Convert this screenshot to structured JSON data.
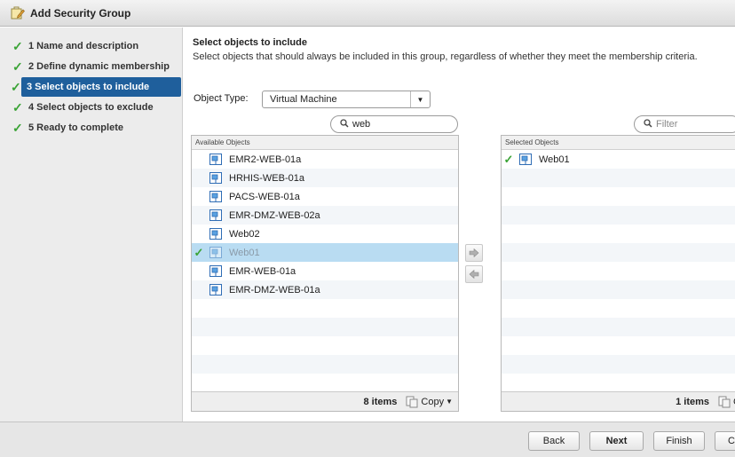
{
  "window": {
    "title": "Add Security Group"
  },
  "steps": [
    {
      "label": "1 Name and description",
      "done": true,
      "active": false
    },
    {
      "label": "2 Define dynamic membership",
      "done": true,
      "active": false
    },
    {
      "label": "3 Select objects to include",
      "done": true,
      "active": true
    },
    {
      "label": "4 Select objects to exclude",
      "done": true,
      "active": false
    },
    {
      "label": "5 Ready to complete",
      "done": true,
      "active": false
    }
  ],
  "header": {
    "title": "Select objects to include",
    "subtitle": "Select objects that should always be included in this group, regardless of whether they meet the membership criteria."
  },
  "object_type": {
    "label": "Object Type:",
    "value": "Virtual Machine"
  },
  "available": {
    "search_value": "web",
    "header": "Available Objects",
    "items": [
      {
        "name": "EMR2-WEB-01a",
        "selected": false
      },
      {
        "name": "HRHIS-WEB-01a",
        "selected": false
      },
      {
        "name": "PACS-WEB-01a",
        "selected": false
      },
      {
        "name": "EMR-DMZ-WEB-02a",
        "selected": false
      },
      {
        "name": "Web02",
        "selected": false
      },
      {
        "name": "Web01",
        "selected": true
      },
      {
        "name": "EMR-WEB-01a",
        "selected": false
      },
      {
        "name": "EMR-DMZ-WEB-01a",
        "selected": false
      }
    ],
    "count": "8 items",
    "copy": "Copy"
  },
  "selected": {
    "search_placeholder": "Filter",
    "header": "Selected Objects",
    "items": [
      {
        "name": "Web01",
        "selected": true
      }
    ],
    "count": "1 items",
    "copy": "C"
  },
  "buttons": {
    "back": "Back",
    "next": "Next",
    "finish": "Finish",
    "cancel": "C"
  },
  "colors": {
    "active_step": "#1f5f9c",
    "check": "#3aa335",
    "row_selected": "#b9dcf2"
  }
}
